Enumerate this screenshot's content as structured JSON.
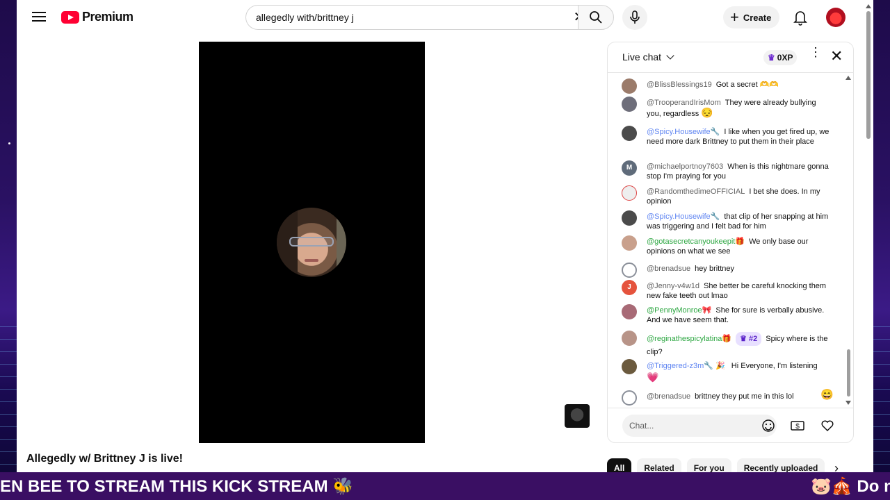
{
  "header": {
    "logo_text": "Premium",
    "search_value": "allegedly with/brittney j",
    "create_label": "Create"
  },
  "video": {
    "title": "Allegedly w/ Brittney J is live!"
  },
  "chat": {
    "title": "Live chat",
    "xp_label": "0XP",
    "input_placeholder": "Chat...",
    "messages": [
      {
        "author": "@BlissBlessings19",
        "text": "Got a secret",
        "emoji": "🫶🫶",
        "avatar_color": "#9b7b6a"
      },
      {
        "author": "@TrooperandIrisMom",
        "text": "They were already bullying you, regardless",
        "emoji": "😔",
        "avatar_color": "#6e6e7a"
      },
      {
        "author": "@Spicy.Housewife",
        "badge": "🔧",
        "text": "I like when you get fired up, we need more dark Brittney to put them in their place",
        "avatar_color": "#4b4b4b"
      },
      {
        "author": "@michaelportnoy7603",
        "text": "When is this nightmare gonna stop I'm praying for you",
        "avatar_letter": "M",
        "avatar_color": "#5f6b7a"
      },
      {
        "author": "@RandomthedimeOFFICIAL",
        "text": "I bet she does. In my opinion",
        "avatar_color": "#e5e5e5"
      },
      {
        "author": "@Spicy.Housewife",
        "badge": "🔧",
        "text": "that clip of her snapping at him was triggering and I felt bad for him",
        "avatar_color": "#4b4b4b"
      },
      {
        "author": "@gotasecretcanyoukeepit",
        "badge": "🎁",
        "text": "We only base our opinions on what we see",
        "avatar_color": "#c9a08c"
      },
      {
        "author": "@brenadsue",
        "text": "hey brittney",
        "avatar_color": "#8a8f99"
      },
      {
        "author": "@Jenny-v4w1d",
        "text": "She better be careful knocking them new fake teeth out lmao",
        "avatar_letter": "J",
        "avatar_color": "#e5533d"
      },
      {
        "author": "@PennyMonroe",
        "badge": "🎀",
        "text": "She for sure is verbally abusive. And we have seem that.",
        "avatar_color": "#a86a76"
      },
      {
        "author": "@reginathespicylatina",
        "badge": "🎁",
        "rank": "#2",
        "text": "Spicy where is the clip?",
        "avatar_color": "#b89488"
      },
      {
        "author": "@Triggered-z3m",
        "badge": "🔧 🎉",
        "text": "Hi Everyone, I'm listening",
        "emoji": "💗",
        "avatar_color": "#6b5a3e"
      },
      {
        "author": "@brenadsue",
        "text": "brittney they put me in this lol",
        "emoji": "😄",
        "avatar_color": "#8a8f99"
      }
    ]
  },
  "chips": [
    "All",
    "Related",
    "For you",
    "Recently uploaded"
  ],
  "ticker": {
    "left_text": "EN BEE TO STREAM THIS KICK STREAM 🐝",
    "right_text": "🐷🎪 Do n"
  }
}
